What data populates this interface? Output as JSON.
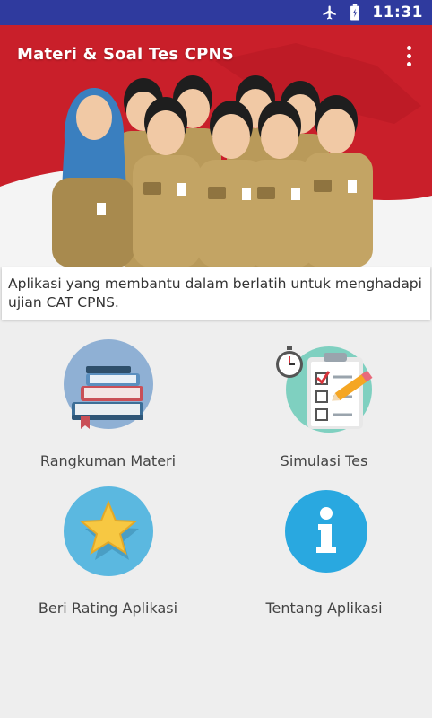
{
  "status_bar": {
    "time": "11:31",
    "icons": [
      "airplane-icon",
      "battery-charging-icon"
    ]
  },
  "app_bar": {
    "title": "Materi & Soal Tes CPNS",
    "menu_icon": "overflow-menu-icon"
  },
  "description": "Aplikasi yang membantu dalam berlatih untuk menghadapi ujian CAT CPNS.",
  "menu": [
    {
      "label": "Rangkuman Materi",
      "icon": "books-icon"
    },
    {
      "label": "Simulasi Tes",
      "icon": "clipboard-test-icon"
    },
    {
      "label": "Beri Rating Aplikasi",
      "icon": "star-icon"
    },
    {
      "label": "Tentang Aplikasi",
      "icon": "info-icon"
    }
  ],
  "colors": {
    "status_bar": "#2f3a9e",
    "hero_red": "#c91f2a",
    "background": "#eeeeee",
    "info_blue": "#29a8e0",
    "star_circle": "#5bb8e0",
    "star": "#f7c842"
  }
}
